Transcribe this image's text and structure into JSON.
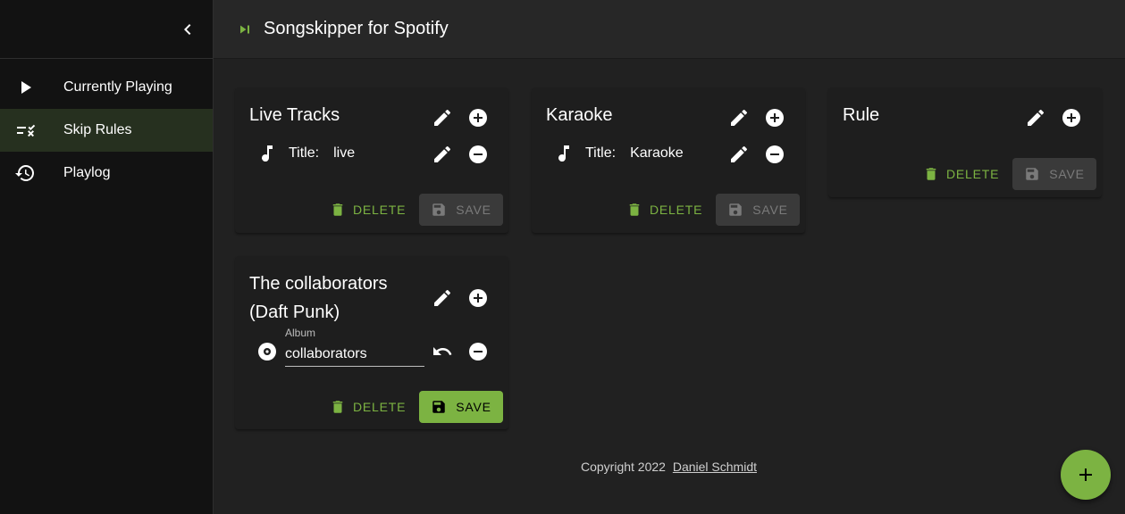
{
  "app": {
    "title": "Songskipper for Spotify",
    "accent": "#7cb342"
  },
  "sidebar": {
    "collapse_icon": "chevron-left-icon",
    "items": [
      {
        "label": "Currently Playing",
        "icon": "play-icon",
        "active": false
      },
      {
        "label": "Skip Rules",
        "icon": "playlist-remove-icon",
        "active": true
      },
      {
        "label": "Playlog",
        "icon": "history-icon",
        "active": false
      }
    ]
  },
  "rules": [
    {
      "title": "Live Tracks",
      "conditions": [
        {
          "icon": "music-note-icon",
          "label": "Title:",
          "value": "live"
        }
      ],
      "delete_label": "DELETE",
      "save_label": "SAVE",
      "save_enabled": false
    },
    {
      "title": "Karaoke",
      "conditions": [
        {
          "icon": "music-note-icon",
          "label": "Title:",
          "value": "Karaoke"
        }
      ],
      "delete_label": "DELETE",
      "save_label": "SAVE",
      "save_enabled": false
    },
    {
      "title": "Rule",
      "conditions": [],
      "delete_label": "DELETE",
      "save_label": "SAVE",
      "save_enabled": false
    },
    {
      "title_line1": "The collaborators",
      "title_line2": "(Daft Punk)",
      "conditions": [
        {
          "icon": "album-icon",
          "field_label": "Album",
          "value": "collaborators",
          "editing": true
        }
      ],
      "delete_label": "DELETE",
      "save_label": "SAVE",
      "save_enabled": true
    }
  ],
  "footer": {
    "copyright": "Copyright 2022",
    "author": "Daniel Schmidt"
  },
  "fab": {
    "icon": "plus-icon"
  }
}
